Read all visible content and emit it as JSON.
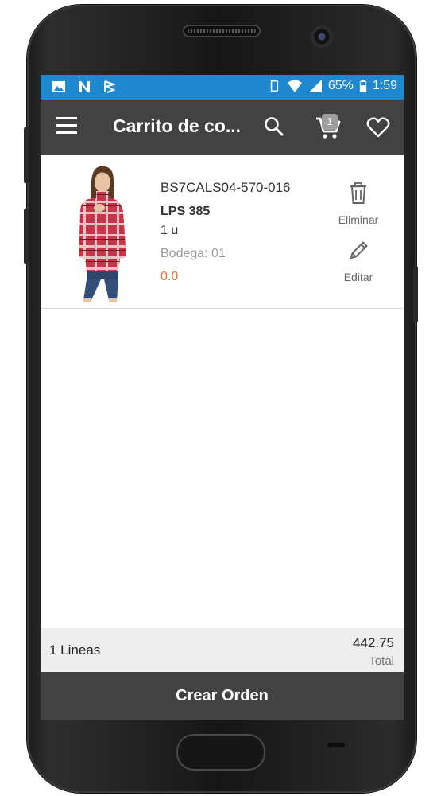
{
  "status_bar": {
    "battery": "65%",
    "time": "1:59",
    "icons": [
      "gallery-icon",
      "n-icon",
      "flag-icon",
      "vibrate-icon",
      "wifi-icon",
      "signal-icon",
      "battery-icon"
    ]
  },
  "app_bar": {
    "title": "Carrito de co...",
    "cart_count": "1",
    "icons": [
      "menu-icon",
      "search-icon",
      "cart-icon",
      "heart-icon"
    ]
  },
  "cart_item": {
    "sku": "BS7CALS04-570-016",
    "price": "LPS 385",
    "quantity": "1 u",
    "warehouse": "Bodega: 01",
    "discount": "0.0",
    "delete_label": "Eliminar",
    "edit_label": "Editar"
  },
  "summary": {
    "lines": "1 Lineas",
    "total_amount": "442.75",
    "total_label": "Total"
  },
  "actions": {
    "create_order": "Crear Orden"
  },
  "colors": {
    "status_bar": "#1e88d0",
    "app_bar": "#424242",
    "discount": "#e0703a",
    "summary_bg": "#eeeeee"
  }
}
